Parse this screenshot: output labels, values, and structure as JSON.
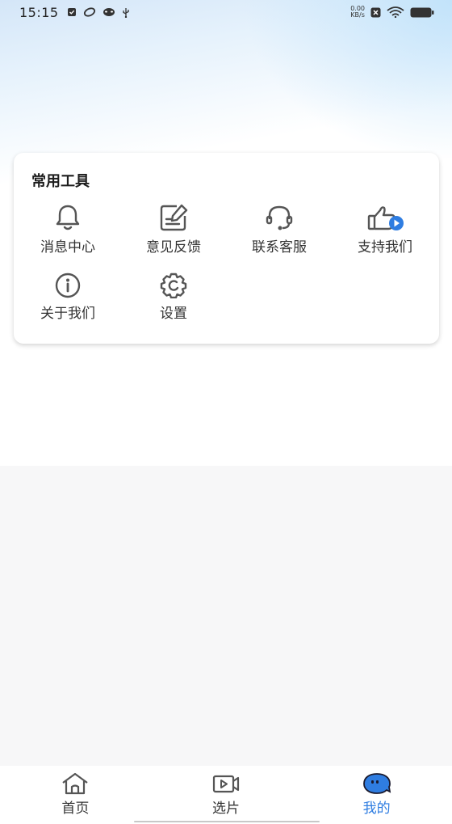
{
  "status_bar": {
    "time": "15:15",
    "net_speed_value": "0.00",
    "net_speed_unit": "KB/s"
  },
  "tools": {
    "title": "常用工具",
    "items": [
      {
        "label": "消息中心",
        "icon": "bell-icon"
      },
      {
        "label": "意见反馈",
        "icon": "feedback-edit-icon"
      },
      {
        "label": "联系客服",
        "icon": "headset-icon"
      },
      {
        "label": "支持我们",
        "icon": "thumbs-up-play-icon"
      },
      {
        "label": "关于我们",
        "icon": "info-icon"
      },
      {
        "label": "设置",
        "icon": "gear-icon"
      }
    ]
  },
  "tab_bar": {
    "tabs": [
      {
        "label": "首页",
        "icon": "home-icon",
        "active": false
      },
      {
        "label": "选片",
        "icon": "video-icon",
        "active": false
      },
      {
        "label": "我的",
        "icon": "profile-bubble-icon",
        "active": true
      }
    ]
  },
  "colors": {
    "accent": "#2f7de1",
    "icon_gray": "#555555",
    "card_bg": "#ffffff"
  }
}
